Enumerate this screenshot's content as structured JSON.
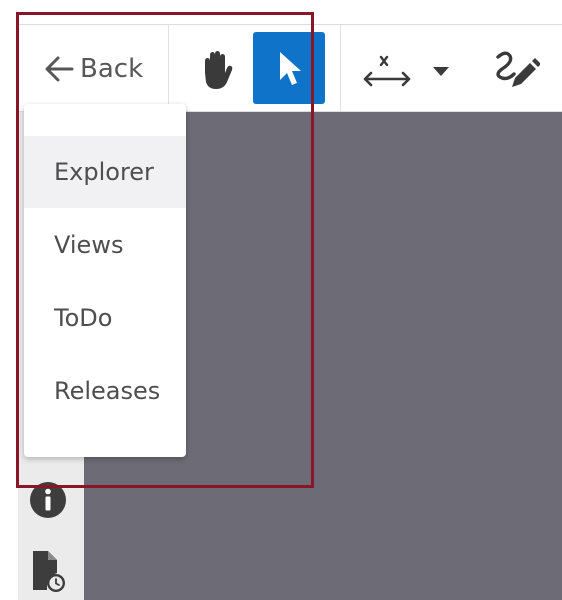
{
  "toolbar": {
    "back_label": "Back",
    "tools": [
      {
        "icon": "hand-pan-icon",
        "active": false
      },
      {
        "icon": "select-pointer-icon",
        "active": true
      },
      {
        "icon": "measure-distance-icon",
        "active": false
      },
      {
        "icon": "caret-down-icon",
        "active": false
      },
      {
        "icon": "draw-pen-icon",
        "active": false
      }
    ],
    "active_color": "#0e73c9"
  },
  "menu": {
    "items": [
      {
        "label": "Explorer",
        "active": true
      },
      {
        "label": "Views",
        "active": false
      },
      {
        "label": "ToDo",
        "active": false
      },
      {
        "label": "Releases",
        "active": false
      }
    ]
  },
  "sidebar": {
    "icons": [
      "info-icon",
      "document-clock-icon"
    ]
  },
  "colors": {
    "canvas": "#6d6c76",
    "highlight_border": "#8a1526"
  }
}
